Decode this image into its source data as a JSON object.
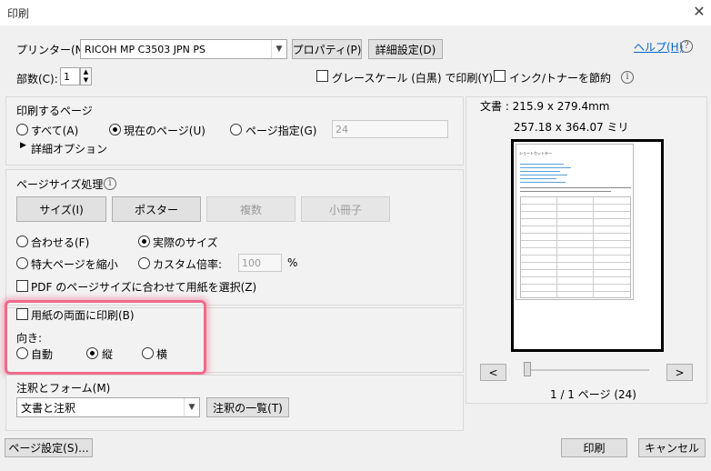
{
  "window": {
    "title": "印刷",
    "close_glyph": "✕"
  },
  "printer": {
    "label": "プリンター(N):",
    "selected": "RICOH MP C3503 JPN PS",
    "properties_button": "プロパティ(P)",
    "advanced_button": "詳細設定(D)",
    "help_link": "ヘルプ(H)",
    "copies_label": "部数(C):",
    "copies_value": "1",
    "grayscale_label": "グレースケール (白黒) で印刷(Y)",
    "save_ink_label": "インク/トナーを節約"
  },
  "pages_to_print": {
    "heading": "印刷するページ",
    "option_all": "すべて(A)",
    "option_current": "現在のページ(U)",
    "option_range": "ページ指定(G)",
    "range_value": "24",
    "more_options": "詳細オプション",
    "selected": "current"
  },
  "page_sizing": {
    "heading": "ページサイズ処理",
    "tab_size": "サイズ(I)",
    "tab_poster": "ポスター",
    "tab_multiple": "複数",
    "tab_booklet": "小冊子",
    "fit": "合わせる(F)",
    "actual_size": "実際のサイズ",
    "shrink_oversized": "特大ページを縮小",
    "custom_scale": "カスタム倍率:",
    "custom_scale_value": "100",
    "percent": "%",
    "choose_paper": "PDF のページサイズに合わせて用紙を選択(Z)",
    "selected": "actual_size"
  },
  "duplex": {
    "label": "用紙の両面に印刷(B)",
    "orientation_label": "向き:",
    "auto": "自動",
    "portrait": "縦",
    "landscape": "横",
    "selected": "portrait"
  },
  "comments": {
    "heading": "注釈とフォーム(M)",
    "selected": "文書と注釈",
    "summarize_button": "注釈の一覧(T)"
  },
  "preview": {
    "document_size": "文書 : 215.9 x 279.4mm",
    "paper_size": "257.18 x 364.07 ミリ",
    "page_status": "1 / 1 ページ (24)",
    "prev": "<",
    "next": ">",
    "doc_heading": "ショートカットキー"
  },
  "footer": {
    "page_setup": "ページ設定(S)...",
    "print": "印刷",
    "cancel": "キャンセル"
  },
  "colors": {
    "highlight": "#f06a8a",
    "link": "#0066cc"
  }
}
